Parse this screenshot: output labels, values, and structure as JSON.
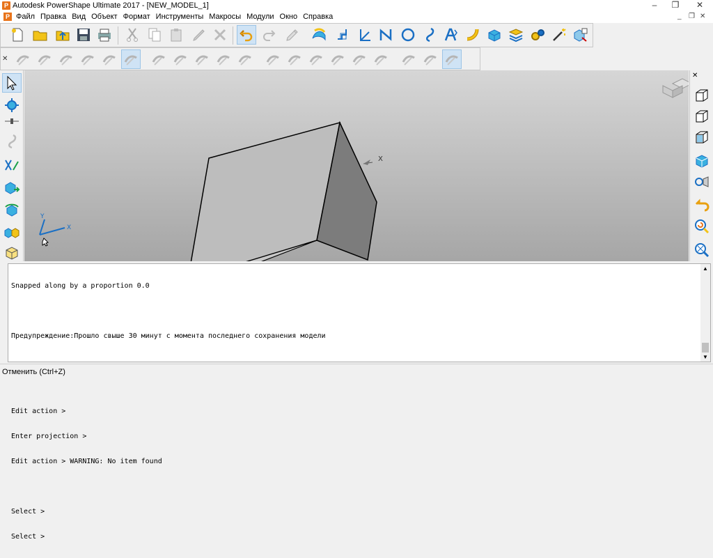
{
  "window": {
    "title": "Autodesk PowerShape Ultimate 2017 - [NEW_MODEL_1]",
    "app_icon": "P"
  },
  "menu": {
    "items": [
      "Файл",
      "Правка",
      "Вид",
      "Объект",
      "Формат",
      "Инструменты",
      "Макросы",
      "Модули",
      "Окно",
      "Справка"
    ]
  },
  "toolbar_main": {
    "icons": [
      "new-file-icon",
      "open-folder-icon",
      "import-icon",
      "save-icon",
      "print-icon",
      "cut-icon",
      "copy-icon",
      "paste-icon",
      "edit-icon",
      "delete-icon",
      "undo-icon",
      "redo-icon",
      "workplane-icon",
      "surface-icon",
      "level-icon",
      "axis-icon",
      "line-icon",
      "circle-icon",
      "curve-icon",
      "text-icon",
      "spline-icon",
      "solid-icon",
      "layers-icon",
      "gear-icon",
      "wand-icon",
      "assembly-icon"
    ]
  },
  "viewport": {
    "axis_x": "X",
    "axis_y": "Y",
    "axis_label_x": "X"
  },
  "command": {
    "lines": [
      "Snapped along by a proportion 0.0",
      "",
      "Предупреждение:Прошло свыше 30 минут с момента последнего сохранения модели",
      "",
      "",
      "Edit action >",
      "Enter projection >",
      "Edit action > WARNING: No item found",
      "",
      "Select >",
      "Select >"
    ]
  },
  "status": {
    "text": "Отменить  (Ctrl+Z)"
  },
  "colors": {
    "accent_orange": "#e8731a",
    "icon_blue": "#1a6fc4",
    "icon_yellow": "#f2c318",
    "active_bg": "#cfe3f5"
  }
}
